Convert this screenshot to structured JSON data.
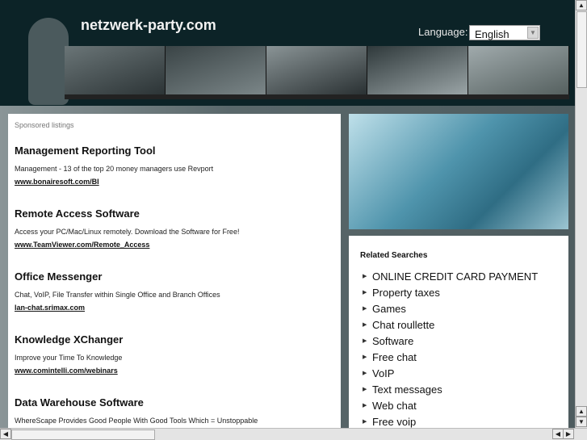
{
  "header": {
    "site_title": "netzwerk-party.com",
    "language_label": "Language:",
    "language_value": "English"
  },
  "ads": {
    "label": "Sponsored listings",
    "items": [
      {
        "title": "Management Reporting Tool",
        "desc": "Management - 13 of the top 20 money managers use Revport",
        "url": "www.bonairesoft.com/BI"
      },
      {
        "title": "Remote Access Software",
        "desc": "Access your PC/Mac/Linux remotely. Download the Software for Free!",
        "url": "www.TeamViewer.com/Remote_Access"
      },
      {
        "title": "Office Messenger",
        "desc": "Chat, VoIP, File Transfer within Single Office and Branch Offices",
        "url": "lan-chat.srimax.com"
      },
      {
        "title": "Knowledge XChanger",
        "desc": "Improve your Time To Knowledge",
        "url": "www.comintelli.com/webinars"
      },
      {
        "title": "Data Warehouse Software",
        "desc": "WhereScape Provides Good People With Good Tools Which = Unstoppable",
        "url": ""
      }
    ]
  },
  "related": {
    "title": "Related Searches",
    "items": [
      "ONLINE CREDIT CARD PAYMENT",
      "Property taxes",
      "Games",
      "Chat roullette",
      "Software",
      "Free chat",
      "VoIP",
      "Text messages",
      "Web chat",
      "Free voip"
    ]
  }
}
